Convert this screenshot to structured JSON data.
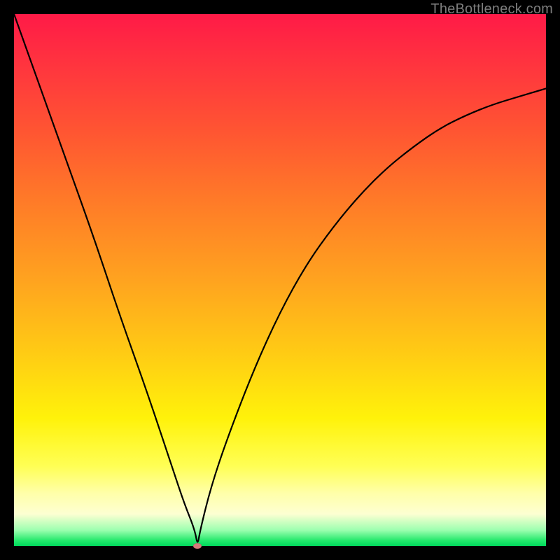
{
  "watermark": "TheBottleneck.com",
  "colors": {
    "curve": "#000000",
    "marker": "#d47a7a",
    "frame": "#000000"
  },
  "chart_data": {
    "type": "line",
    "title": "",
    "xlabel": "",
    "ylabel": "",
    "xlim": [
      0,
      100
    ],
    "ylim": [
      0,
      100
    ],
    "grid": false,
    "legend": false,
    "series": [
      {
        "name": "bottleneck-curve",
        "x": [
          0,
          5,
          10,
          15,
          20,
          25,
          30,
          32,
          34,
          34.5,
          35,
          37,
          40,
          45,
          50,
          55,
          60,
          65,
          70,
          75,
          80,
          85,
          90,
          95,
          100
        ],
        "values": [
          100,
          86,
          72,
          58,
          43,
          29,
          14,
          8,
          3,
          0,
          3,
          11,
          20,
          33,
          44,
          53,
          60,
          66,
          71,
          75,
          78.5,
          81,
          83,
          84.5,
          86
        ]
      }
    ],
    "marker": {
      "x": 34.5,
      "y": 0
    }
  }
}
